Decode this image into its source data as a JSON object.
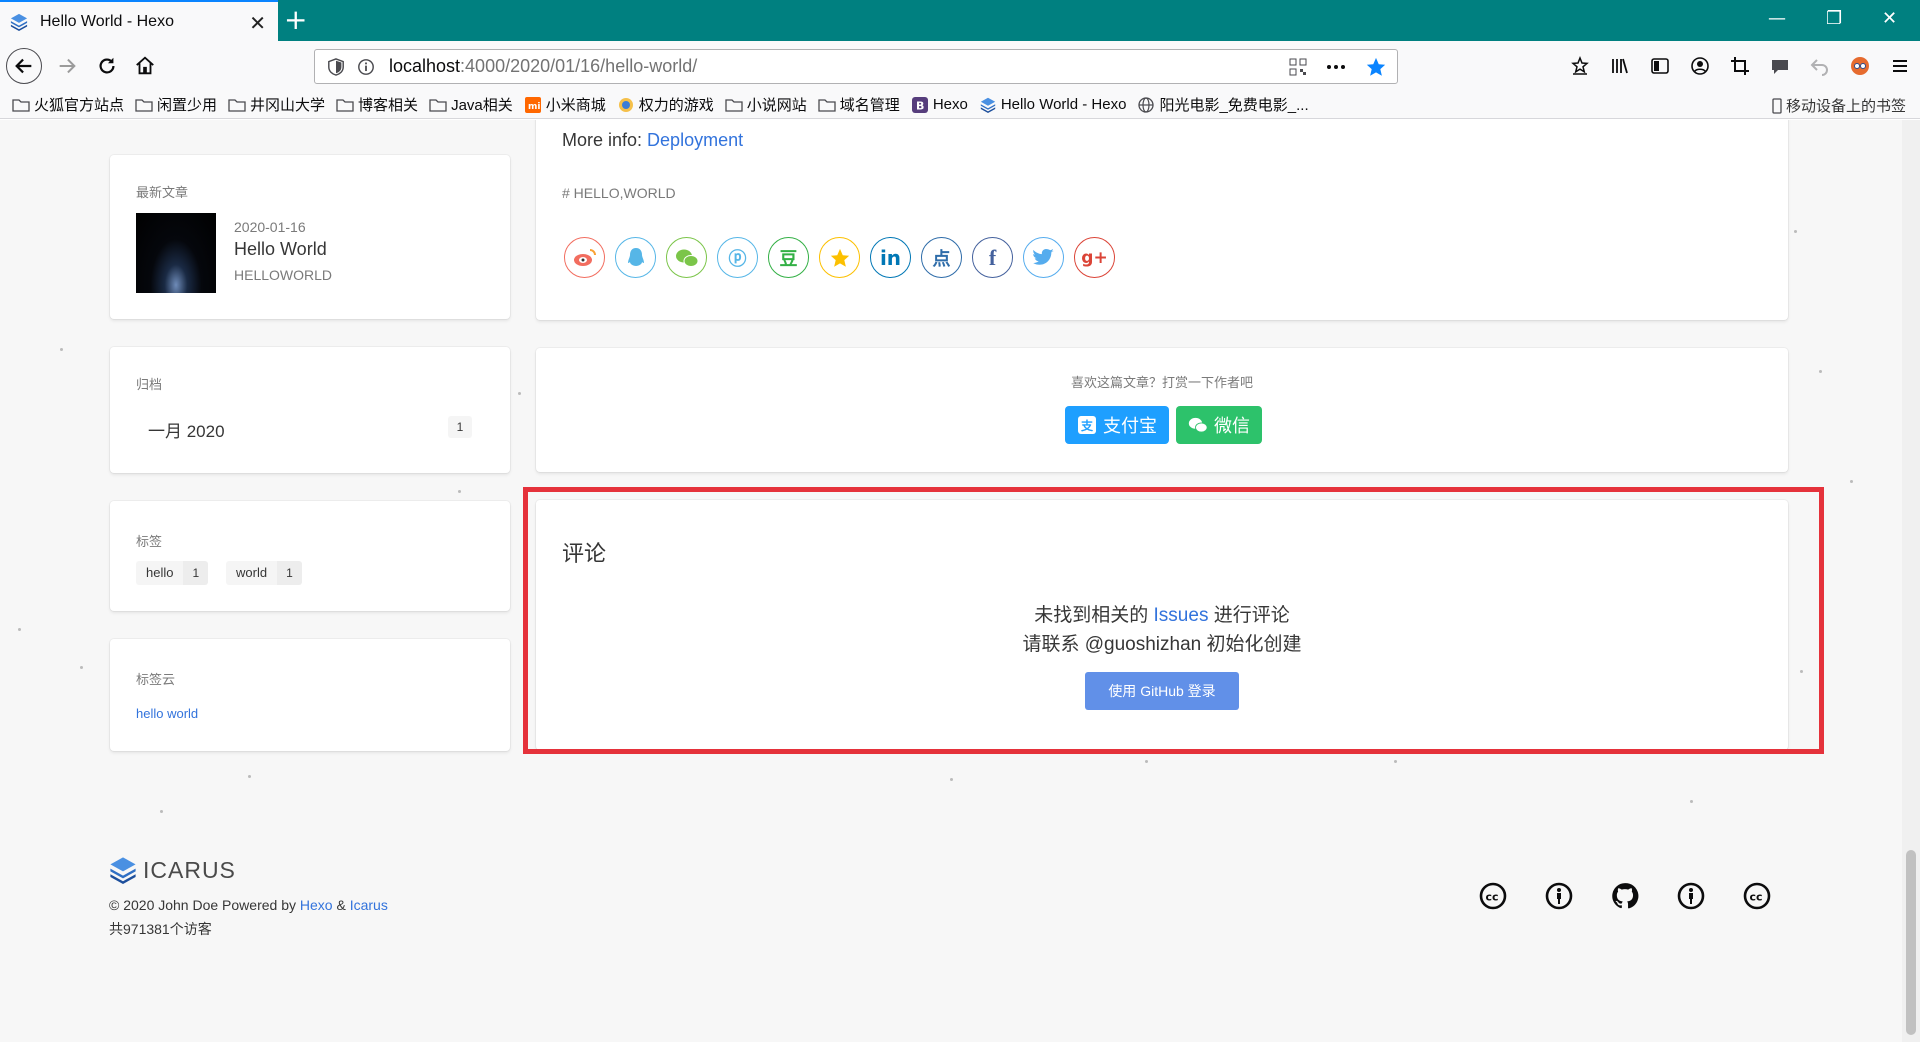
{
  "browser": {
    "tab_title": "Hello World - Hexo",
    "new_tab_symbol": "+",
    "url_host": "localhost",
    "url_path": ":4000/2020/01/16/hello-world/",
    "window_controls": {
      "minimize": "—",
      "restore": "❐",
      "close": "✕"
    }
  },
  "bookmarks": [
    {
      "label": "火狐官方站点",
      "icon": "folder-icon"
    },
    {
      "label": "闲置少用",
      "icon": "folder-icon"
    },
    {
      "label": "井冈山大学",
      "icon": "folder-icon"
    },
    {
      "label": "博客相关",
      "icon": "folder-icon"
    },
    {
      "label": "Java相关",
      "icon": "folder-icon"
    },
    {
      "label": "小米商城",
      "icon": "mi-icon"
    },
    {
      "label": "权力的游戏",
      "icon": "globe-badge-icon"
    },
    {
      "label": "小说网站",
      "icon": "folder-icon"
    },
    {
      "label": "域名管理",
      "icon": "folder-icon"
    },
    {
      "label": "Hexo",
      "icon": "bootstrap-b-icon"
    },
    {
      "label": "Hello World - Hexo",
      "icon": "hexo-layers-icon"
    },
    {
      "label": "阳光电影_免费电影_...",
      "icon": "globe-icon"
    }
  ],
  "bookmarks_mobile": "移动设备上的书签",
  "sidebar": {
    "recent": {
      "title": "最新文章",
      "date": "2020-01-16",
      "post_title": "Hello World",
      "category": "HELLOWORLD"
    },
    "archives": {
      "title": "归档",
      "item": "一月 2020",
      "count": "1"
    },
    "tags": {
      "title": "标签",
      "items": [
        {
          "name": "hello",
          "count": "1"
        },
        {
          "name": "world",
          "count": "1"
        }
      ]
    },
    "tagcloud": {
      "title": "标签云",
      "link": "hello world"
    }
  },
  "article": {
    "more_info_prefix": "More info: ",
    "more_info_link": "Deployment",
    "tags_text": "# HELLO,WORLD",
    "share_icons": [
      "weibo",
      "qq",
      "wechat",
      "qzone",
      "douban",
      "star",
      "in",
      "点",
      "f",
      "twitter",
      "g+"
    ]
  },
  "donate": {
    "text": "喜欢这篇文章？打赏一下作者吧",
    "alipay": "支付宝",
    "wechat": "微信"
  },
  "comments": {
    "title": "评论",
    "line1_prefix": "未找到相关的 ",
    "line1_link": "Issues",
    "line1_suffix": " 进行评论",
    "line2": "请联系 @guoshizhan 初始化创建",
    "login_button": "使用 GitHub 登录"
  },
  "footer": {
    "logo_text": "ICARUS",
    "copyright_prefix": "© 2020 John Doe  Powered by ",
    "hexo": "Hexo",
    "amp": " & ",
    "icarus": "Icarus",
    "visits": "共971381个访客",
    "icons": [
      "cc-icon",
      "accessibility-icon",
      "github-icon",
      "accessibility-icon",
      "cc-icon"
    ]
  },
  "colors": {
    "titlebar": "#008080",
    "link": "#3273dc",
    "alipay": "#1e9fff",
    "wechat": "#2dc26b",
    "github_login": "#6190e8",
    "highlight": "#e5323b"
  }
}
